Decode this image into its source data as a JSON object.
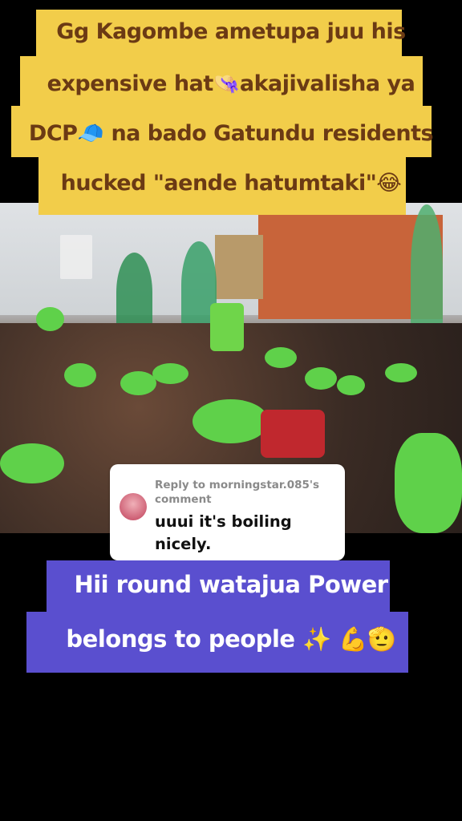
{
  "top_caption": {
    "lines": [
      "Gg Kagombe ametupa juu his",
      "expensive hat👒akajivalisha ya",
      "DCP🧢 na bado Gatundu residents",
      "hucked \"aende hatumtaki\"😂"
    ]
  },
  "reply_card": {
    "header": "Reply to morningstar.085's comment",
    "comment": "uuui it's boiling nicely."
  },
  "bottom_caption": {
    "lines": [
      "Hii round watajua Power",
      "belongs to people ✨ 💪🫡"
    ]
  },
  "colors": {
    "top_caption_bg": "#f2cd4a",
    "top_caption_text": "#6b3a14",
    "bottom_caption_bg": "#5a4fcf",
    "bottom_caption_text": "#ffffff"
  }
}
